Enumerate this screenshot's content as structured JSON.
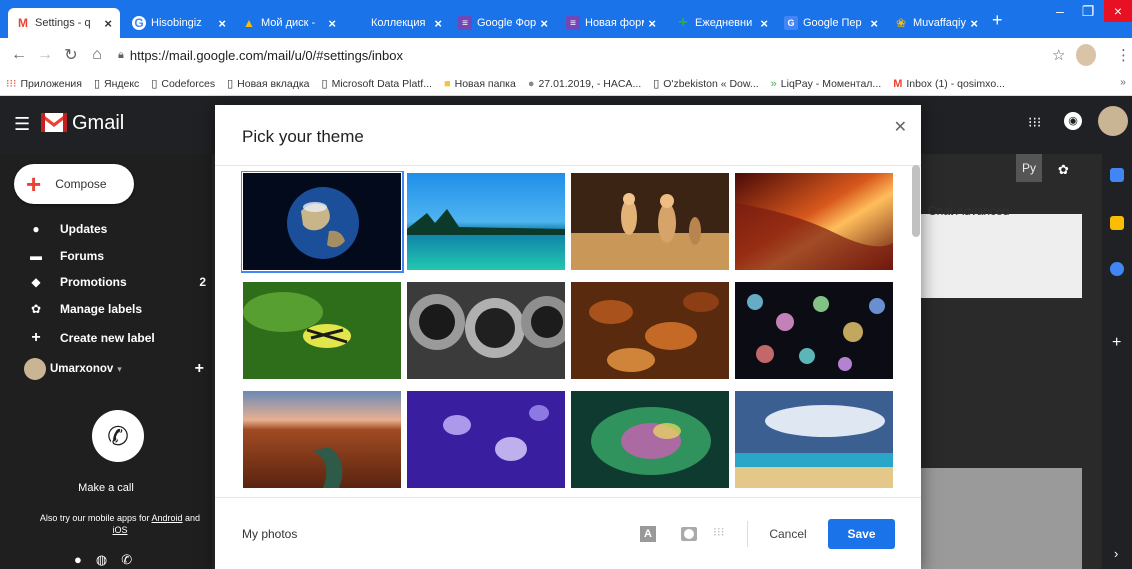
{
  "browser": {
    "tabs": [
      {
        "label": "Settings - q",
        "icon": "gmail-favicon",
        "active": true
      },
      {
        "label": "Hisobingiz",
        "icon": "google-favicon"
      },
      {
        "label": "Мой диск -",
        "icon": "drive-favicon"
      },
      {
        "label": "Коллекция",
        "icon": "blank-favicon"
      },
      {
        "label": "Google Фор",
        "icon": "forms-favicon"
      },
      {
        "label": "Новая форм",
        "icon": "forms-favicon"
      },
      {
        "label": "Ежедневни",
        "icon": "plus-favicon"
      },
      {
        "label": "Google Пер",
        "icon": "translate-favicon"
      },
      {
        "label": "Muvaffaqiy",
        "icon": "site-favicon"
      }
    ],
    "url": "https://mail.google.com/mail/u/0/#settings/inbox",
    "bookmarks": [
      {
        "label": "Приложения",
        "icon": "apps-icon"
      },
      {
        "label": "Яндекс",
        "icon": "page-icon"
      },
      {
        "label": "Codeforces",
        "icon": "page-icon"
      },
      {
        "label": "Новая вкладка",
        "icon": "page-icon"
      },
      {
        "label": "Microsoft Data Platf...",
        "icon": "page-icon"
      },
      {
        "label": "Новая папка",
        "icon": "folder-icon"
      },
      {
        "label": "27.01.2019, - HACA...",
        "icon": "site-icon"
      },
      {
        "label": "O'zbekiston « Dow...",
        "icon": "page-icon"
      },
      {
        "label": "LiqPay - Моментал...",
        "icon": "liqpay-icon"
      },
      {
        "label": "Inbox (1) - qosimxo...",
        "icon": "gmail-icon"
      }
    ]
  },
  "gmail": {
    "title": "Gmail",
    "compose": "Compose",
    "nav": [
      {
        "label": "Updates",
        "icon": "info-icon",
        "count": ""
      },
      {
        "label": "Forums",
        "icon": "forum-icon",
        "count": ""
      },
      {
        "label": "Promotions",
        "icon": "tag-icon",
        "count": "2"
      },
      {
        "label": "Manage labels",
        "icon": "gear-icon",
        "count": ""
      },
      {
        "label": "Create new label",
        "icon": "plus-icon",
        "count": ""
      }
    ],
    "chat_user": "Umarxonov",
    "make_call": "Make a call",
    "mobile_apps_prefix": "Also try our mobile apps for",
    "android": "Android",
    "and": "and",
    "ios": "iOS",
    "settings_tabs": "Chat  Advanced",
    "input_tools": "Ру"
  },
  "dialog": {
    "title": "Pick your theme",
    "my_photos": "My photos",
    "cancel": "Cancel",
    "save": "Save",
    "text_bg": "A",
    "themes": [
      {
        "name": "earth",
        "selected": true
      },
      {
        "name": "lake"
      },
      {
        "name": "chess"
      },
      {
        "name": "canyon-red"
      },
      {
        "name": "caterpillar"
      },
      {
        "name": "pipes"
      },
      {
        "name": "leaves"
      },
      {
        "name": "bokeh"
      },
      {
        "name": "canyon-river"
      },
      {
        "name": "jellyfish"
      },
      {
        "name": "bubble"
      },
      {
        "name": "beach"
      }
    ]
  }
}
